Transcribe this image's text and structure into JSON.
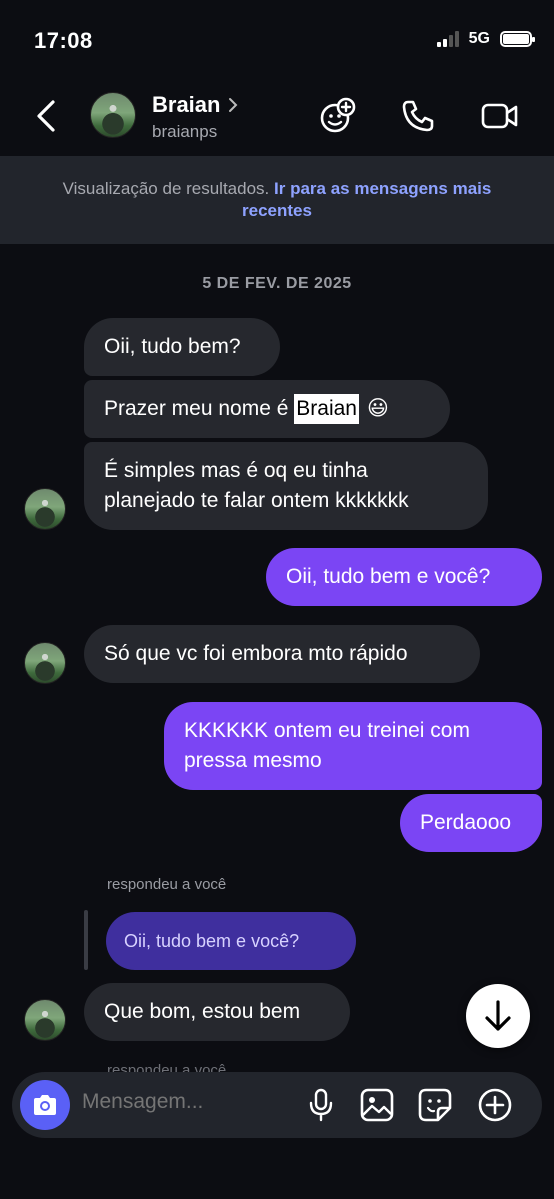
{
  "status_bar": {
    "time": "17:08",
    "network": "5G"
  },
  "header": {
    "contact_name": "Braian",
    "username": "braianps"
  },
  "banner": {
    "text": "Visualização de resultados.",
    "link": "Ir para as mensagens mais recentes"
  },
  "date_separator": "5 DE FEV. DE 2025",
  "messages": {
    "m1": "Oii, tudo bem?",
    "m2_prefix": "Prazer meu nome é ",
    "m2_highlight": "Braian",
    "m2_emoji": "😃",
    "m3_line1": "É simples mas é oq eu tinha",
    "m3_line2": "planejado te falar ontem kkkkkkk",
    "m4": "Oii, tudo bem e você?",
    "m5": "Só que vc foi embora mto rápido",
    "m6_line1": "KKKKKK ontem eu treinei com",
    "m6_line2": "pressa mesmo",
    "m7": "Perdaooo",
    "reply_label": "respondeu a você",
    "reply_quote": "Oii, tudo bem e você?",
    "m8": "Que bom, estou bem",
    "reply_label_2": "respondeu a você"
  },
  "composer": {
    "placeholder": "Mensagem..."
  },
  "colors": {
    "sent": "#7b45f4",
    "received": "#26282e",
    "accent_link": "#8ea2ff",
    "camera": "#5a60f6"
  }
}
